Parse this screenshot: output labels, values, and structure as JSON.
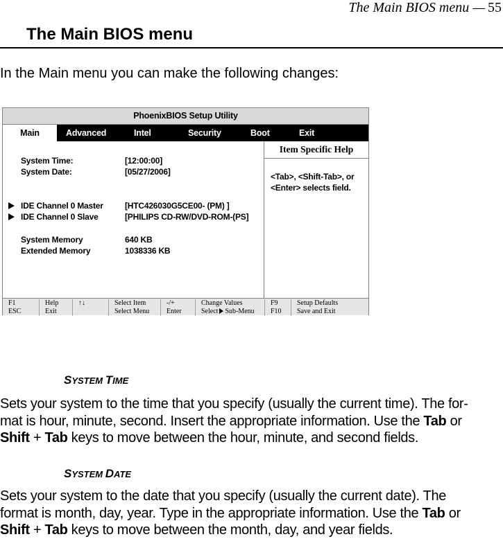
{
  "running_head": {
    "title": "The Main BIOS menu —",
    "page": "55"
  },
  "section_title": "The Main BIOS menu",
  "intro": "In the Main menu you can make the following changes:",
  "bios": {
    "title": "PhoenixBIOS Setup Utility",
    "tabs": [
      "Main",
      "Advanced",
      "Intel",
      "Security",
      "Boot",
      "Exit"
    ],
    "active_tab": "Main",
    "items": [
      {
        "label": "System Time:",
        "value": "[12:00:00]",
        "submenu": false
      },
      {
        "label": "System Date:",
        "value": "[05/27/2006]",
        "submenu": false
      },
      {
        "label": "IDE Channel 0 Master",
        "value": "[HTC426030G5CE00- (PM) ]",
        "submenu": true
      },
      {
        "label": "IDE Channel 0 Slave",
        "value": "[PHILIPS CD-RW/DVD-ROM-(PS]",
        "submenu": true
      },
      {
        "label": "System Memory",
        "value": "640 KB",
        "submenu": false
      },
      {
        "label": "Extended Memory",
        "value": "1038336 KB",
        "submenu": false
      }
    ],
    "help": {
      "title": "Item Specific Help",
      "line1": "<Tab>,  <Shift-Tab>,  or",
      "line2": "<Enter> selects field."
    },
    "footer": {
      "f1": "F1",
      "esc": "ESC",
      "help": "Help",
      "exit": "Exit",
      "arrows": "↑↓",
      "select_item": "Select Item",
      "select_menu": "Select Menu",
      "minus_plus": "-/+",
      "enter": "Enter",
      "change_values": "Change Values",
      "select": "Select",
      "sub_menu": "Sub-Menu",
      "f9": "F9",
      "f10": "F10",
      "setup_defaults": "Setup Defaults",
      "save_exit": "Save and Exit"
    }
  },
  "sections": [
    {
      "heading_cap1": "S",
      "heading_rest1": "YSTEM ",
      "heading_cap2": "T",
      "heading_rest2": "IME",
      "line1": "Sets your system to the time that you specify (usually the current time). The for-",
      "line2_pre": "mat is hour, minute, second. Insert the appropriate information. Use the ",
      "key_tab": "Tab",
      "or": " or",
      "key_shift": "Shift",
      "plus": " + ",
      "line3_post": " keys to move between the hour, minute, and second fields."
    },
    {
      "heading_cap1": "S",
      "heading_rest1": "YSTEM ",
      "heading_cap2": "D",
      "heading_rest2": "ATE",
      "line1": "Sets your system to the date that you specify (usually the current date). The",
      "line2_pre": "format is month, day, year. Type in the appropriate information. Use the ",
      "key_tab": "Tab",
      "or": " or",
      "key_shift": "Shift",
      "plus": " + ",
      "line3_post": " keys to move between the month, day, and year fields."
    }
  ]
}
